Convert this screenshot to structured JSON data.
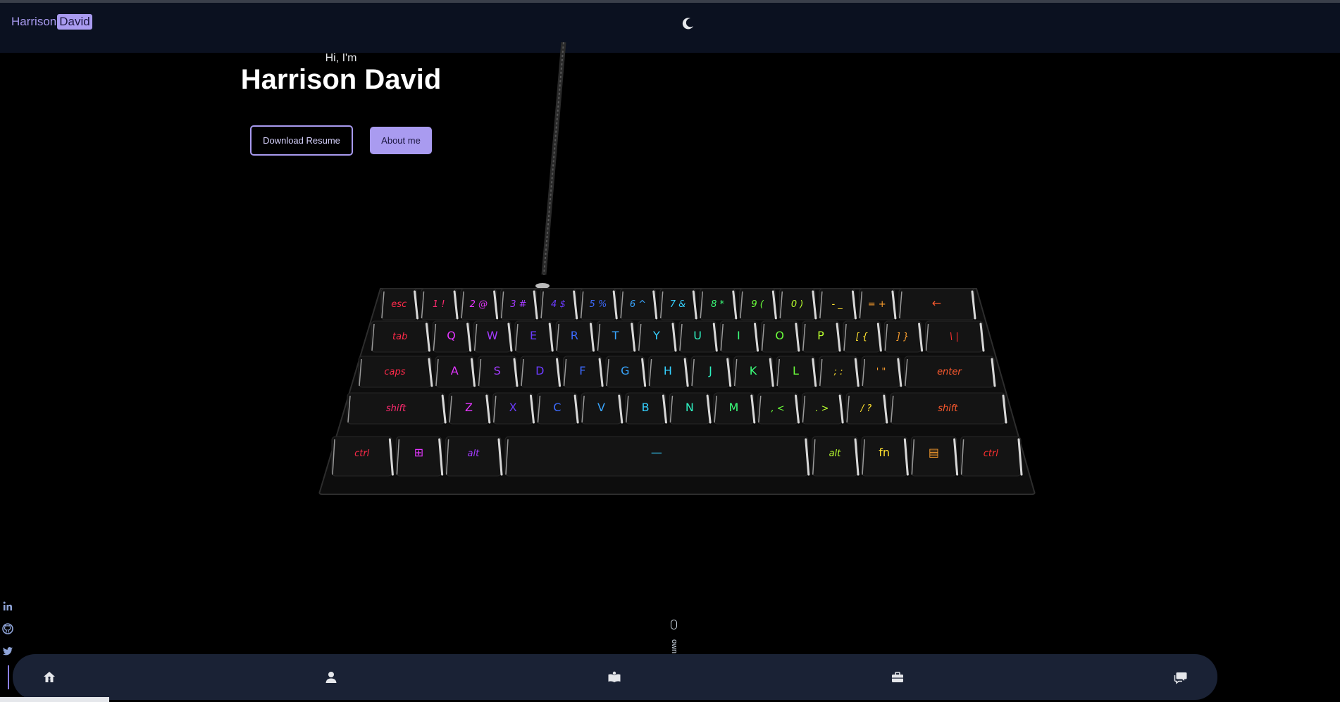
{
  "header": {
    "logo_first": "Harrison",
    "logo_last": "David",
    "theme_toggle_icon": "moon-icon"
  },
  "hero": {
    "greeting": "Hi, I'm",
    "name": "Harrison David",
    "download_button": "Download Resume",
    "about_button": "About me"
  },
  "keyboard": {
    "rows": [
      [
        "esc",
        "1 !",
        "2 @",
        "3 #",
        "4 $",
        "5 %",
        "6 ^",
        "7 &",
        "8 *",
        "9 (",
        "0 )",
        "- _",
        "= +",
        "←"
      ],
      [
        "tab",
        "Q",
        "W",
        "E",
        "R",
        "T",
        "Y",
        "U",
        "I",
        "O",
        "P",
        "[ {",
        "] }",
        "\\ |"
      ],
      [
        "caps",
        "A",
        "S",
        "D",
        "F",
        "G",
        "H",
        "J",
        "K",
        "L",
        "; :",
        "' \"",
        " enter"
      ],
      [
        "shift",
        "Z",
        "X",
        "C",
        "V",
        "B",
        "N",
        "M",
        ", <",
        ". >",
        "/ ?",
        "shift"
      ],
      [
        "ctrl",
        "⊞",
        "alt",
        "—",
        "alt",
        "fn",
        "▤",
        "ctrl"
      ]
    ]
  },
  "socials": [
    {
      "icon": "linkedin-icon",
      "label": "in"
    },
    {
      "icon": "github-icon",
      "label": ""
    },
    {
      "icon": "twitter-icon",
      "label": ""
    }
  ],
  "scroll_hint": {
    "text": "own"
  },
  "bottom_nav": [
    {
      "icon": "home-icon"
    },
    {
      "icon": "user-icon"
    },
    {
      "icon": "book-icon"
    },
    {
      "icon": "briefcase-icon"
    },
    {
      "icon": "chat-icon"
    }
  ],
  "colors": {
    "accent": "#a99bf0",
    "header_bg": "#0b1120",
    "nav_bg": "#1a2235"
  }
}
